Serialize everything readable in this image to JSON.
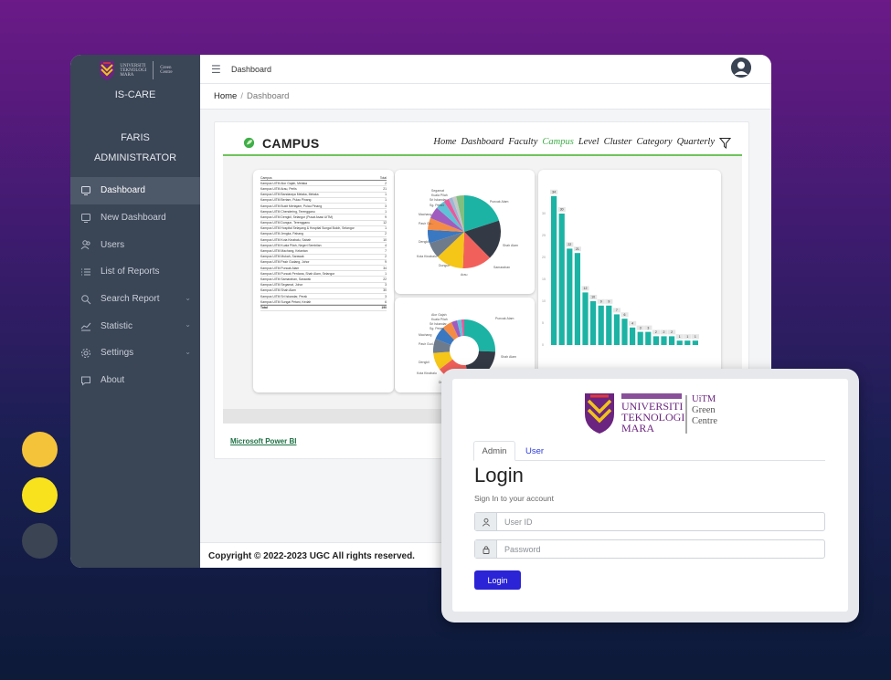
{
  "decor": {
    "dot_colors": [
      "#f5c33a",
      "#f8e21e",
      "#3b4453"
    ]
  },
  "sidebar": {
    "brand_lines": [
      "UNIVERSITI",
      "TEKNOLOGI",
      "MARA"
    ],
    "brand_right_lines": [
      "Green",
      "Centre"
    ],
    "app_title": "IS-CARE",
    "user_name": "FARIS",
    "user_role": "ADMINISTRATOR",
    "items": [
      {
        "label": "Dashboard",
        "icon": "monitor-icon",
        "active": true
      },
      {
        "label": "New Dashboard",
        "icon": "monitor-icon"
      },
      {
        "label": "Users",
        "icon": "users-icon"
      },
      {
        "label": "List of Reports",
        "icon": "list-icon"
      },
      {
        "label": "Search Report",
        "icon": "search-icon",
        "caret": true
      },
      {
        "label": "Statistic",
        "icon": "chart-icon",
        "caret": true
      },
      {
        "label": "Settings",
        "icon": "gear-icon",
        "caret": true
      },
      {
        "label": "About",
        "icon": "chat-icon"
      }
    ]
  },
  "topbar": {
    "title": "Dashboard",
    "avatar_icon": "user-avatar-icon"
  },
  "breadcrumb": {
    "home": "Home",
    "separator": "/",
    "current": "Dashboard"
  },
  "report": {
    "title": "CAMPUS",
    "nav": [
      "Home",
      "Dashboard",
      "Faculty",
      "Campus",
      "Level",
      "Cluster",
      "Category",
      "Quarterly"
    ],
    "active_nav": "Campus",
    "accent_color": "#3fae49",
    "filter_icon": "filter-icon",
    "table": {
      "headers": [
        "Campus",
        "Total"
      ],
      "rows": [
        [
          "Kampus UiTM Alor Gajah, Melaka",
          "2"
        ],
        [
          "Kampus UiTM Arau, Perlis",
          "21"
        ],
        [
          "Kampus UiTM Bandaraya Melaka, Melaka",
          "1"
        ],
        [
          "Kampus UiTM Bertam, Pulau Pinang",
          "1"
        ],
        [
          "Kampus UiTM Bukit Mertajam, Pulau Pinang",
          "3"
        ],
        [
          "Kampus UiTM Chendering, Terengganu",
          "1"
        ],
        [
          "Kampus UiTM Dengkil, Selangor (Pusat Asasi UiTM)",
          "9"
        ],
        [
          "Kampus UiTM Dungun, Terengganu",
          "12"
        ],
        [
          "Kampus UiTM Hospital Selayang & Hospital Sungai Buloh, Selangor",
          "1"
        ],
        [
          "Kampus UiTM Jengka, Pahang",
          "2"
        ],
        [
          "Kampus UiTM Kota Kinabalu, Sabah",
          "10"
        ],
        [
          "Kampus UiTM Kuala Pilah, Negeri Sembilan",
          "4"
        ],
        [
          "Kampus UiTM Machang, Kelantan",
          "7"
        ],
        [
          "Kampus UiTM Mukah, Sarawak",
          "2"
        ],
        [
          "Kampus UiTM Pasir Gudang, Johor",
          "9"
        ],
        [
          "Kampus UiTM Puncak Alam",
          "34"
        ],
        [
          "Kampus UiTM Puncak Perdana, Shah Alam, Selangor",
          "1"
        ],
        [
          "Kampus UiTM Samarahan, Sarawak",
          "22"
        ],
        [
          "Kampus UiTM Segamat, Johor",
          "3"
        ],
        [
          "Kampus UiTM Shah Alam",
          "30"
        ],
        [
          "Kampus UiTM Sri Iskandar, Perak",
          "3"
        ],
        [
          "Kampus UiTM Sungai Petani, Kedah",
          "6"
        ]
      ],
      "total_label": "Total",
      "total_value": "190"
    },
    "pie1_labels": [
      "Segamat",
      "Kuala Pilah",
      "Sri Iskandar",
      "Sg. Petani",
      "Machang",
      "Pasir Gu...",
      "Dengkil",
      "Kota Kinabalu",
      "Dungun",
      "Arau",
      "Samarahan",
      "Shah Alam",
      "Puncak Alam"
    ],
    "pie2_labels": [
      "Alor Gajah",
      "Kuala Pilah",
      "Sri Iskandar",
      "Sg. Petani",
      "Machang",
      "Pasir Gud...",
      "Dengkil",
      "Kota Kinabalu",
      "Dungun",
      "Puncak Alam",
      "Shah Alam"
    ],
    "bar_top_labels": [
      "34",
      "30",
      "22",
      "21",
      "12",
      "10",
      "9",
      "9",
      "7",
      "6",
      "4",
      "3",
      "3",
      "2",
      "2",
      "2",
      "1",
      "1",
      "1"
    ],
    "link": "Microsoft Power BI"
  },
  "footer": {
    "copyright": "Copyright © 2022-2023 UGC All rights reserved."
  },
  "login": {
    "logo_left_lines": [
      "UNIVERSITI",
      "TEKNOLOGI",
      "MARA"
    ],
    "logo_right_lines": [
      "UiTM",
      "Green",
      "Centre"
    ],
    "tabs": [
      "Admin",
      "User"
    ],
    "active_tab": "Admin",
    "title": "Login",
    "subtitle": "Sign In to your account",
    "userid_placeholder": "User ID",
    "password_placeholder": "Password",
    "button": "Login",
    "button_color": "#2b24d6"
  }
}
